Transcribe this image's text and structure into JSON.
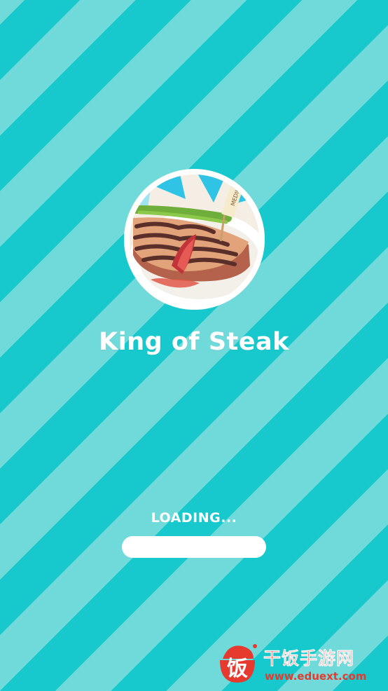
{
  "app": {
    "title": "King of Steak",
    "loading_text": "LOADING...",
    "progress": 0.0
  },
  "logo": {
    "icon": "steak-plate-icon",
    "flag_text": "MEDIUM"
  },
  "watermark": {
    "icon": "rice-bowl-logo-icon",
    "glyph": "饭",
    "name": "干饭手游网",
    "url": "www.eduext.com"
  },
  "colors": {
    "stripe_dark": "#17c9cc",
    "stripe_light": "#6fdad9",
    "text": "#ffffff",
    "watermark": "#e63a2e"
  }
}
